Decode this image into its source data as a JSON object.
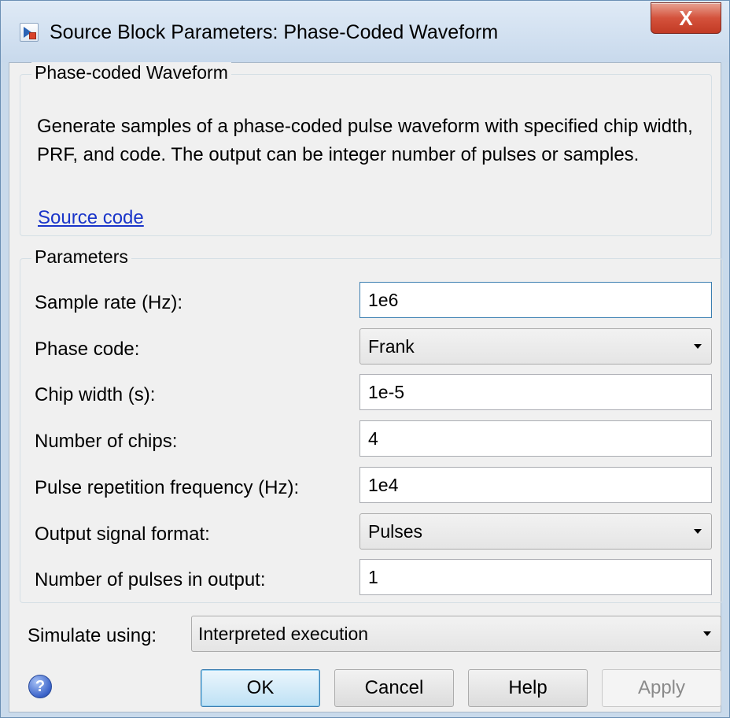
{
  "window": {
    "title": "Source Block Parameters: Phase-Coded Waveform",
    "close_label": "X"
  },
  "description_group": {
    "legend": "Phase-coded Waveform",
    "text": "Generate samples of a phase-coded pulse waveform with specified chip width, PRF, and code. The output can be integer number of pulses or samples.",
    "link": "Source code"
  },
  "parameters": {
    "legend": "Parameters",
    "sample_rate": {
      "label": "Sample rate (Hz):",
      "value": "1e6"
    },
    "phase_code": {
      "label": "Phase code:",
      "value": "Frank"
    },
    "chip_width": {
      "label": "Chip width (s):",
      "value": "1e-5"
    },
    "num_chips": {
      "label": "Number of chips:",
      "value": "4"
    },
    "prf": {
      "label": "Pulse repetition frequency (Hz):",
      "value": "1e4"
    },
    "output_format": {
      "label": "Output signal format:",
      "value": "Pulses"
    },
    "num_pulses": {
      "label": "Number of pulses in output:",
      "value": "1"
    }
  },
  "simulate": {
    "label": "Simulate using:",
    "value": "Interpreted execution"
  },
  "buttons": {
    "ok": "OK",
    "cancel": "Cancel",
    "help": "Help",
    "apply": "Apply"
  },
  "help_icon_glyph": "?",
  "colors": {
    "link": "#1a35c9",
    "default_button_border": "#3c7fb1",
    "close_button": "#d4523c",
    "title_bar": "#c8d9ec"
  }
}
